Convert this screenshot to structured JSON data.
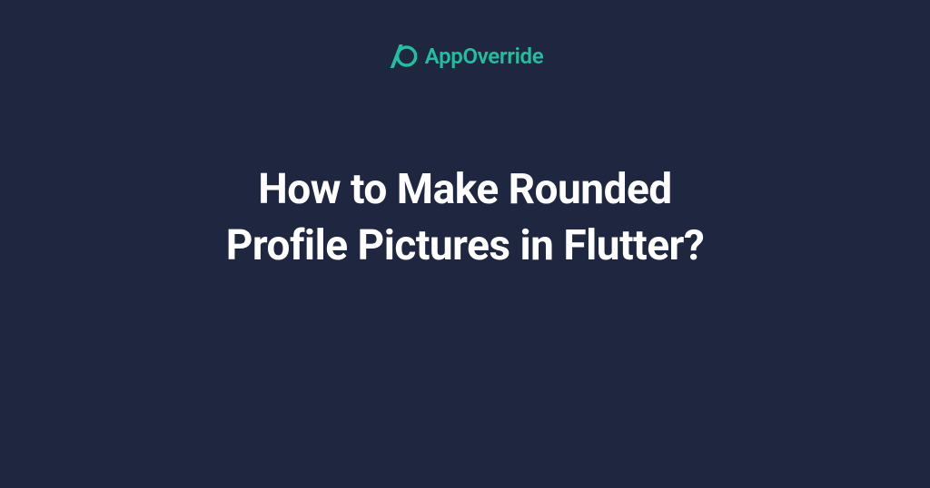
{
  "brand": {
    "name": "AppOverride",
    "accent_color": "#1fbfa0"
  },
  "title": {
    "line1": "How to Make Rounded",
    "line2": "Profile Pictures in Flutter?"
  },
  "colors": {
    "background": "#1e2640",
    "text": "#ffffff",
    "accent": "#1fbfa0"
  }
}
